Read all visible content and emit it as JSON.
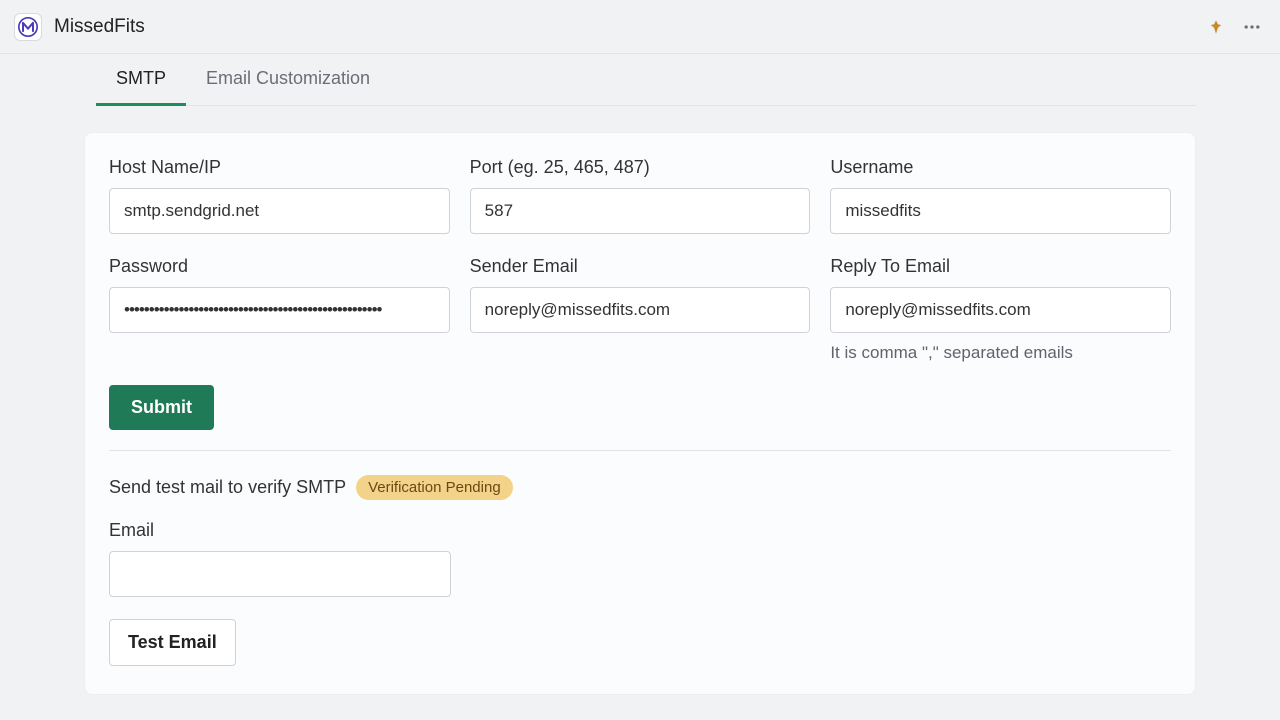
{
  "header": {
    "app_name": "MissedFits"
  },
  "tabs": {
    "smtp": "SMTP",
    "email_customization": "Email Customization"
  },
  "fields": {
    "host_label": "Host Name/IP",
    "host_value": "smtp.sendgrid.net",
    "port_label": "Port (eg. 25, 465, 487)",
    "port_value": "587",
    "username_label": "Username",
    "username_value": "missedfits",
    "password_label": "Password",
    "password_value": "••••••••••••••••••••••••••••••••••••••••••••••••••••",
    "sender_label": "Sender Email",
    "sender_value": "noreply@missedfits.com",
    "reply_label": "Reply To Email",
    "reply_value": "noreply@missedfits.com",
    "reply_help": "It is comma \",\" separated emails"
  },
  "buttons": {
    "submit": "Submit",
    "test_email": "Test Email"
  },
  "verify": {
    "text": "Send test mail to verify SMTP",
    "badge": "Verification Pending",
    "email_label": "Email",
    "email_value": ""
  }
}
